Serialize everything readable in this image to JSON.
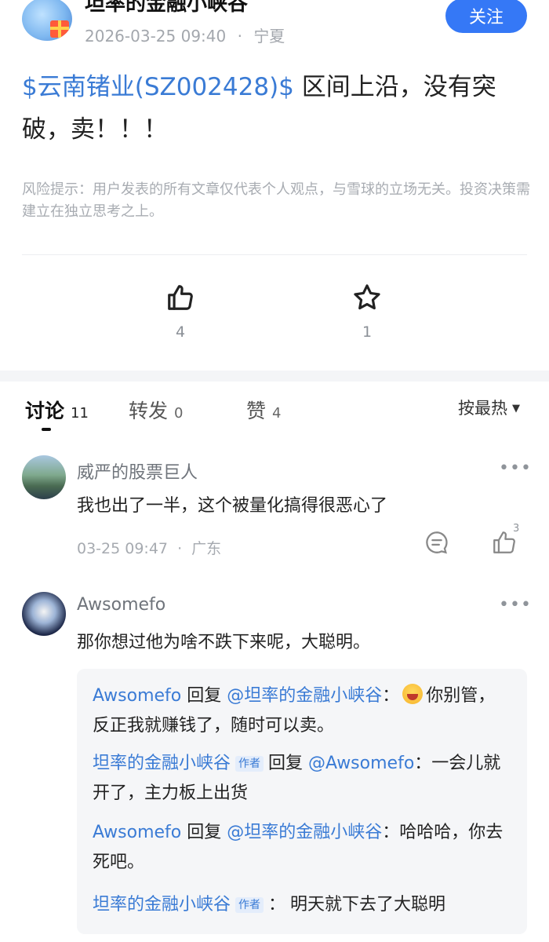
{
  "author": {
    "name": "坦率的金融小峡谷",
    "timestamp": "2026-03-25 09:40",
    "separator": "·",
    "location": "宁夏",
    "follow_label": "关注"
  },
  "post": {
    "stock_link": "$云南锗业(SZ002428)$",
    "text": " 区间上沿，没有突破，卖！！！",
    "risk_note": "风险提示：用户发表的所有文章仅代表个人观点，与雪球的立场无关。投资决策需建立在独立思考之上。"
  },
  "actions": {
    "like_count": "4",
    "favorite_count": "1"
  },
  "tabs": [
    {
      "label": "讨论",
      "count": "11"
    },
    {
      "label": "转发",
      "count": "0"
    },
    {
      "label": "赞",
      "count": "4"
    }
  ],
  "sort": {
    "label": "按最热",
    "caret": "▼"
  },
  "comments": [
    {
      "name": "威严的股票巨人",
      "text": "我也出了一半，这个被量化搞得很恶心了",
      "time": "03-25 09:47",
      "location": "广东",
      "like_count": "3",
      "more": "•••"
    },
    {
      "name": "Awsomefo",
      "text": "那你想过他为啥不跌下来呢，大聪明。",
      "more": "•••",
      "replies": [
        {
          "from": "Awsomefo",
          "verb": "回复",
          "to": "@坦率的金融小峡谷",
          "colon": "：",
          "text": "你别管，反正我就赚钱了，随时可以卖。"
        },
        {
          "from": "坦率的金融小峡谷",
          "tag": "作者",
          "verb": "回复",
          "to": "@Awsomefo",
          "colon": "：",
          "text": "一会儿就开了，主力板上出货"
        },
        {
          "from": "Awsomefo",
          "verb": "回复",
          "to": "@坦率的金融小峡谷",
          "colon": "：",
          "text": "哈哈哈，你去死吧。"
        },
        {
          "from": "坦率的金融小峡谷",
          "tag": "作者",
          "colon": "：",
          "text": "明天就下去了大聪明"
        }
      ]
    }
  ],
  "colors": {
    "accent": "#3578f6",
    "link": "#3a7bd5",
    "muted": "#a6aab0"
  }
}
